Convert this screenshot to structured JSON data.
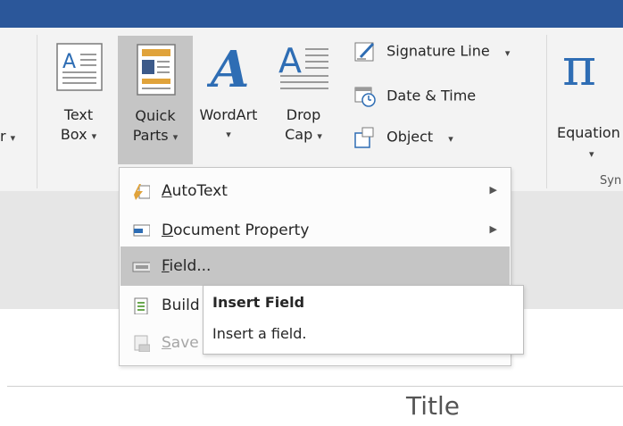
{
  "ribbon": {
    "partial_left": {
      "label": "r",
      "caret": "▾"
    },
    "text_box": {
      "line1": "Text",
      "line2": "Box",
      "caret": "▾"
    },
    "quick_parts": {
      "line1": "Quick",
      "line2": "Parts",
      "caret": "▾"
    },
    "wordart": {
      "label": "WordArt",
      "caret": "▾"
    },
    "drop_cap": {
      "line1": "Drop",
      "line2": "Cap",
      "caret": "▾"
    },
    "signature_line": {
      "label": "Signature Line",
      "caret": "▾"
    },
    "date_time": {
      "label": "Date & Time"
    },
    "object": {
      "label": "Object",
      "caret": "▾"
    },
    "equation": {
      "label": "Equation",
      "caret": "▾"
    },
    "symbols_group": {
      "label": "Syn"
    }
  },
  "menu": {
    "items": [
      {
        "pre": "",
        "accel": "A",
        "post": "utoText",
        "has_submenu": true,
        "arrow": "▶"
      },
      {
        "pre": "",
        "accel": "D",
        "post": "ocument Property",
        "has_submenu": true,
        "arrow": "▶"
      },
      {
        "pre": "",
        "accel": "F",
        "post": "ield...",
        "selected": true
      },
      {
        "pre": "Build",
        "accel": "",
        "post": ""
      },
      {
        "pre": "",
        "accel": "S",
        "post": "ave",
        "disabled": true
      }
    ]
  },
  "tooltip": {
    "title": "Insert Field",
    "description": "Insert a field."
  },
  "document": {
    "title": "Title"
  },
  "colors": {
    "titlebar": "#2b579a",
    "ribbon": "#f3f3f3",
    "highlight": "#c5c5c5",
    "wordart": "#2e6db4"
  }
}
